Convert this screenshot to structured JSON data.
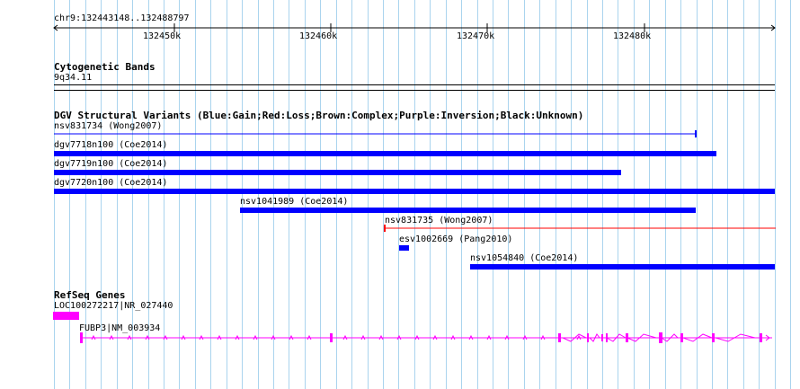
{
  "ruler": {
    "location": "chr9:132443148..132488797",
    "ticks": [
      "132450k",
      "132460k",
      "132470k",
      "132480k"
    ]
  },
  "cytoband": {
    "title": "Cytogenetic Bands",
    "band": "9q34.11"
  },
  "dgv": {
    "title": "DGV Structural Variants (Blue:Gain;Red:Loss;Brown:Complex;Purple:Inversion;Black:Unknown)",
    "features": [
      {
        "label": "nsv831734 (Wong2007)",
        "color": "#0000ff",
        "style": "thin-line"
      },
      {
        "label": "dgv7718n100 (Coe2014)",
        "color": "#0000ff",
        "style": "bar"
      },
      {
        "label": "dgv7719n100 (Coe2014)",
        "color": "#0000ff",
        "style": "bar"
      },
      {
        "label": "dgv7720n100 (Coe2014)",
        "color": "#0000ff",
        "style": "bar"
      },
      {
        "label": "nsv1041989 (Coe2014)",
        "color": "#0000ff",
        "style": "bar"
      },
      {
        "label": "nsv831735 (Wong2007)",
        "color": "#ff0000",
        "style": "thin-line"
      },
      {
        "label": "esv1002669 (Pang2010)",
        "color": "#0000ff",
        "style": "bar"
      },
      {
        "label": "nsv1054840 (Coe2014)",
        "color": "#0000ff",
        "style": "bar"
      }
    ]
  },
  "refseq": {
    "title": "RefSeq Genes",
    "genes": [
      {
        "label": "LOC100272217|NR_027440",
        "color": "#ff00ff"
      },
      {
        "label": "FUBP3|NM_003934",
        "color": "#ff00ff"
      }
    ]
  }
}
